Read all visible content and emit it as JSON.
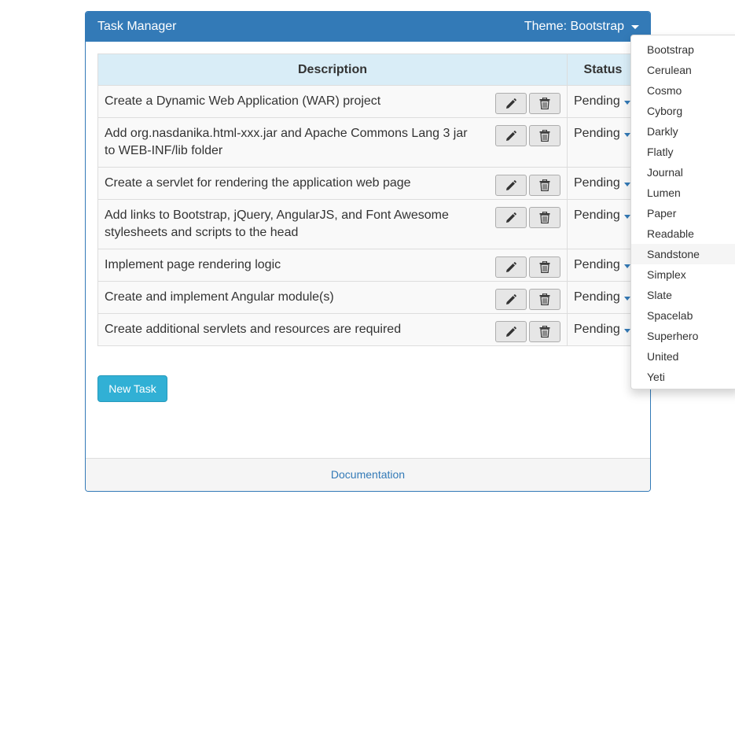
{
  "panel": {
    "title": "Task Manager",
    "theme_label": "Theme: Bootstrap"
  },
  "table": {
    "headers": {
      "description": "Description",
      "status": "Status"
    },
    "rows": [
      {
        "description": "Create a Dynamic Web Application (WAR) project",
        "status": "Pending"
      },
      {
        "description": "Add org.nasdanika.html-xxx.jar and Apache Commons Lang 3 jar to WEB-INF/lib folder",
        "status": "Pending"
      },
      {
        "description": "Create a servlet for rendering the application web page",
        "status": "Pending"
      },
      {
        "description": "Add links to Bootstrap, jQuery, AngularJS, and Font Awesome stylesheets and scripts to the head",
        "status": "Pending"
      },
      {
        "description": "Implement page rendering logic",
        "status": "Pending"
      },
      {
        "description": "Create and implement Angular module(s)",
        "status": "Pending"
      },
      {
        "description": "Create additional servlets and resources are required",
        "status": "Pending"
      }
    ]
  },
  "new_task_label": "New Task",
  "footer": {
    "documentation_link": "Documentation"
  },
  "theme_menu": {
    "items": [
      "Bootstrap",
      "Cerulean",
      "Cosmo",
      "Cyborg",
      "Darkly",
      "Flatly",
      "Journal",
      "Lumen",
      "Paper",
      "Readable",
      "Sandstone",
      "Simplex",
      "Slate",
      "Spacelab",
      "Superhero",
      "United",
      "Yeti"
    ],
    "highlighted": "Sandstone"
  },
  "icons": {
    "edit": "pencil-icon",
    "delete": "trash-icon",
    "caret": "caret-down-icon"
  },
  "colors": {
    "primary": "#337ab7",
    "info": "#31b0d5",
    "header_bg": "#d9edf7"
  }
}
